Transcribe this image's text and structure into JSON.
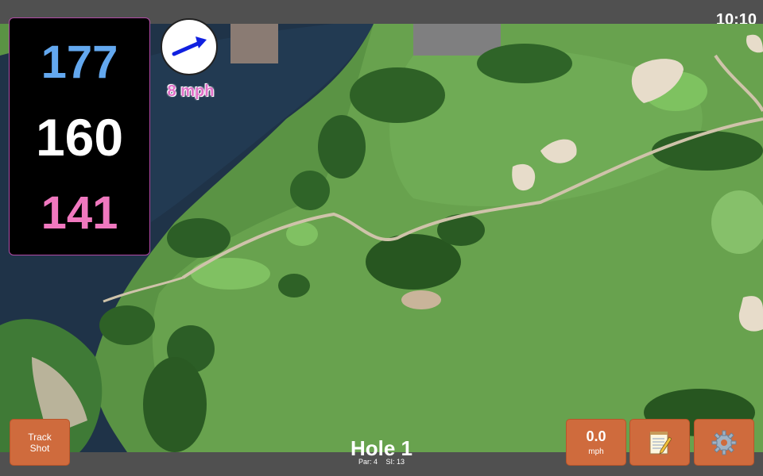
{
  "status": {
    "time": "10:10"
  },
  "distances": {
    "back": "177",
    "middle": "160",
    "front": "141",
    "colors": {
      "back": "#63a8ef",
      "middle": "#ffffff",
      "front": "#f078bf"
    }
  },
  "wind": {
    "speed_label": "8 mph",
    "arrow_color": "#1020e0",
    "text_color": "#e070c8",
    "icon": "wind-arrow-icon"
  },
  "hole": {
    "title": "Hole 1",
    "par": "Par: 4",
    "si": "SI: 13"
  },
  "buttons": {
    "track_shot_line1": "Track",
    "track_shot_line2": "Shot",
    "wind_value": "0.0",
    "wind_unit": "mph",
    "notes_icon": "notepad-icon",
    "settings_icon": "gear-icon",
    "accent": "#cf6b3d"
  }
}
